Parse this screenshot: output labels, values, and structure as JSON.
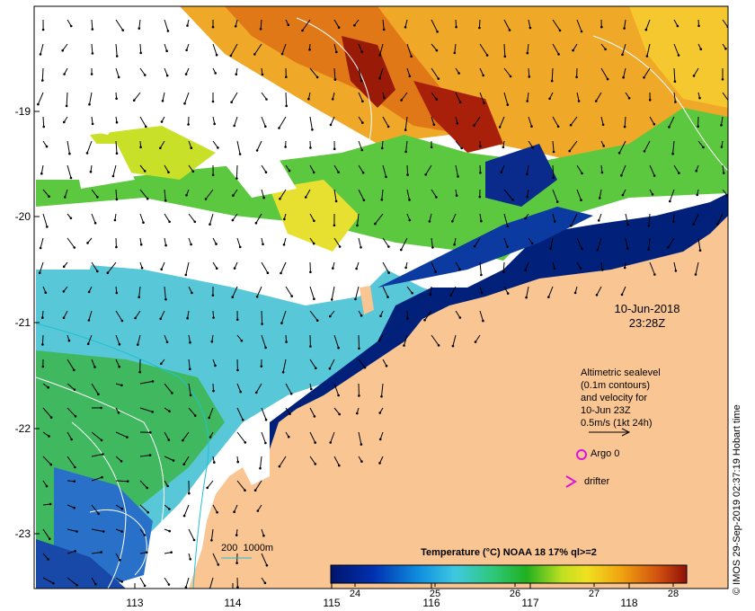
{
  "map": {
    "y_ticks": [
      "-19",
      "-20",
      "-21",
      "-22",
      "-23"
    ],
    "x_ticks": [
      "113",
      "114",
      "115",
      "116",
      "117",
      "118"
    ],
    "date": "10-Jun-2018",
    "time": "23:28Z",
    "credit": "© IMOS 29-Sep-2019 02:37:19 Hobart time",
    "legend_lines": [
      "Altimetric sealevel",
      "(0.1m contours)",
      "and velocity for",
      "10-Jun 23Z",
      "0.5m/s (1kt 24h)"
    ],
    "argo_label": "Argo 0",
    "drifter_label": "drifter",
    "depth_label": "200  1000m",
    "colorbar_title": "Temperature (°C) NOAA 18 17% ql>=2",
    "colorbar_ticks": [
      "24",
      "25",
      "26",
      "27",
      "28"
    ],
    "colors": {
      "land": "#f9c593",
      "cold": "#00207a",
      "warm": "#b51d00",
      "marker": "#e010e0",
      "isobath": "#20c0d0"
    }
  }
}
